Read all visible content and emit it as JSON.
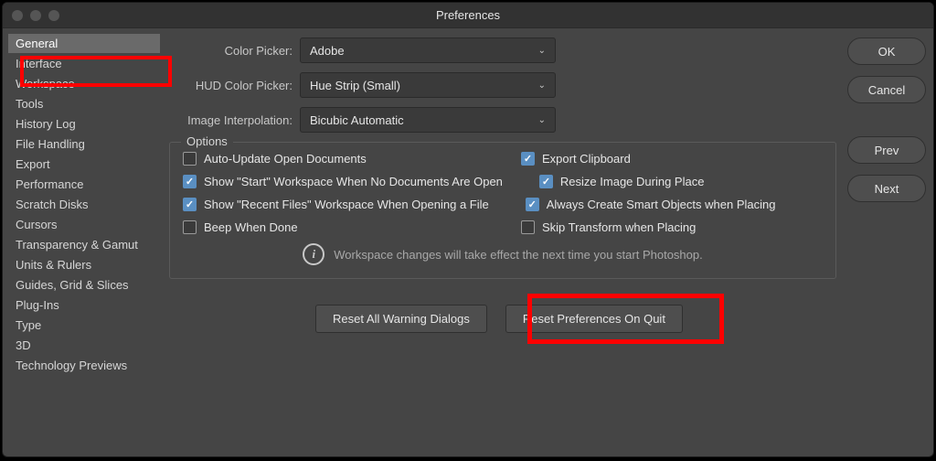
{
  "window": {
    "title": "Preferences"
  },
  "sidebar": {
    "items": [
      {
        "label": "General",
        "selected": true
      },
      {
        "label": "Interface"
      },
      {
        "label": "Workspace"
      },
      {
        "label": "Tools"
      },
      {
        "label": "History Log"
      },
      {
        "label": "File Handling"
      },
      {
        "label": "Export"
      },
      {
        "label": "Performance"
      },
      {
        "label": "Scratch Disks"
      },
      {
        "label": "Cursors"
      },
      {
        "label": "Transparency & Gamut"
      },
      {
        "label": "Units & Rulers"
      },
      {
        "label": "Guides, Grid & Slices"
      },
      {
        "label": "Plug-Ins"
      },
      {
        "label": "Type"
      },
      {
        "label": "3D"
      },
      {
        "label": "Technology Previews"
      }
    ]
  },
  "form": {
    "color_picker": {
      "label": "Color Picker:",
      "value": "Adobe"
    },
    "hud_color_picker": {
      "label": "HUD Color Picker:",
      "value": "Hue Strip (Small)"
    },
    "image_interpolation": {
      "label": "Image Interpolation:",
      "value": "Bicubic Automatic"
    }
  },
  "options": {
    "title": "Options",
    "left": [
      {
        "label": "Auto-Update Open Documents",
        "checked": false
      },
      {
        "label": "Show \"Start\" Workspace When No Documents Are Open",
        "checked": true
      },
      {
        "label": "Show \"Recent Files\" Workspace When Opening a File",
        "checked": true
      },
      {
        "label": "Beep When Done",
        "checked": false
      }
    ],
    "right": [
      {
        "label": "Export Clipboard",
        "checked": true
      },
      {
        "label": "Resize Image During Place",
        "checked": true
      },
      {
        "label": "Always Create Smart Objects when Placing",
        "checked": true
      },
      {
        "label": "Skip Transform when Placing",
        "checked": false
      }
    ],
    "info": "Workspace changes will take effect the next time you start Photoshop."
  },
  "actions": {
    "reset_warnings": "Reset All Warning Dialogs",
    "reset_prefs": "Reset Preferences On Quit"
  },
  "right_buttons": {
    "ok": "OK",
    "cancel": "Cancel",
    "prev": "Prev",
    "next": "Next"
  }
}
